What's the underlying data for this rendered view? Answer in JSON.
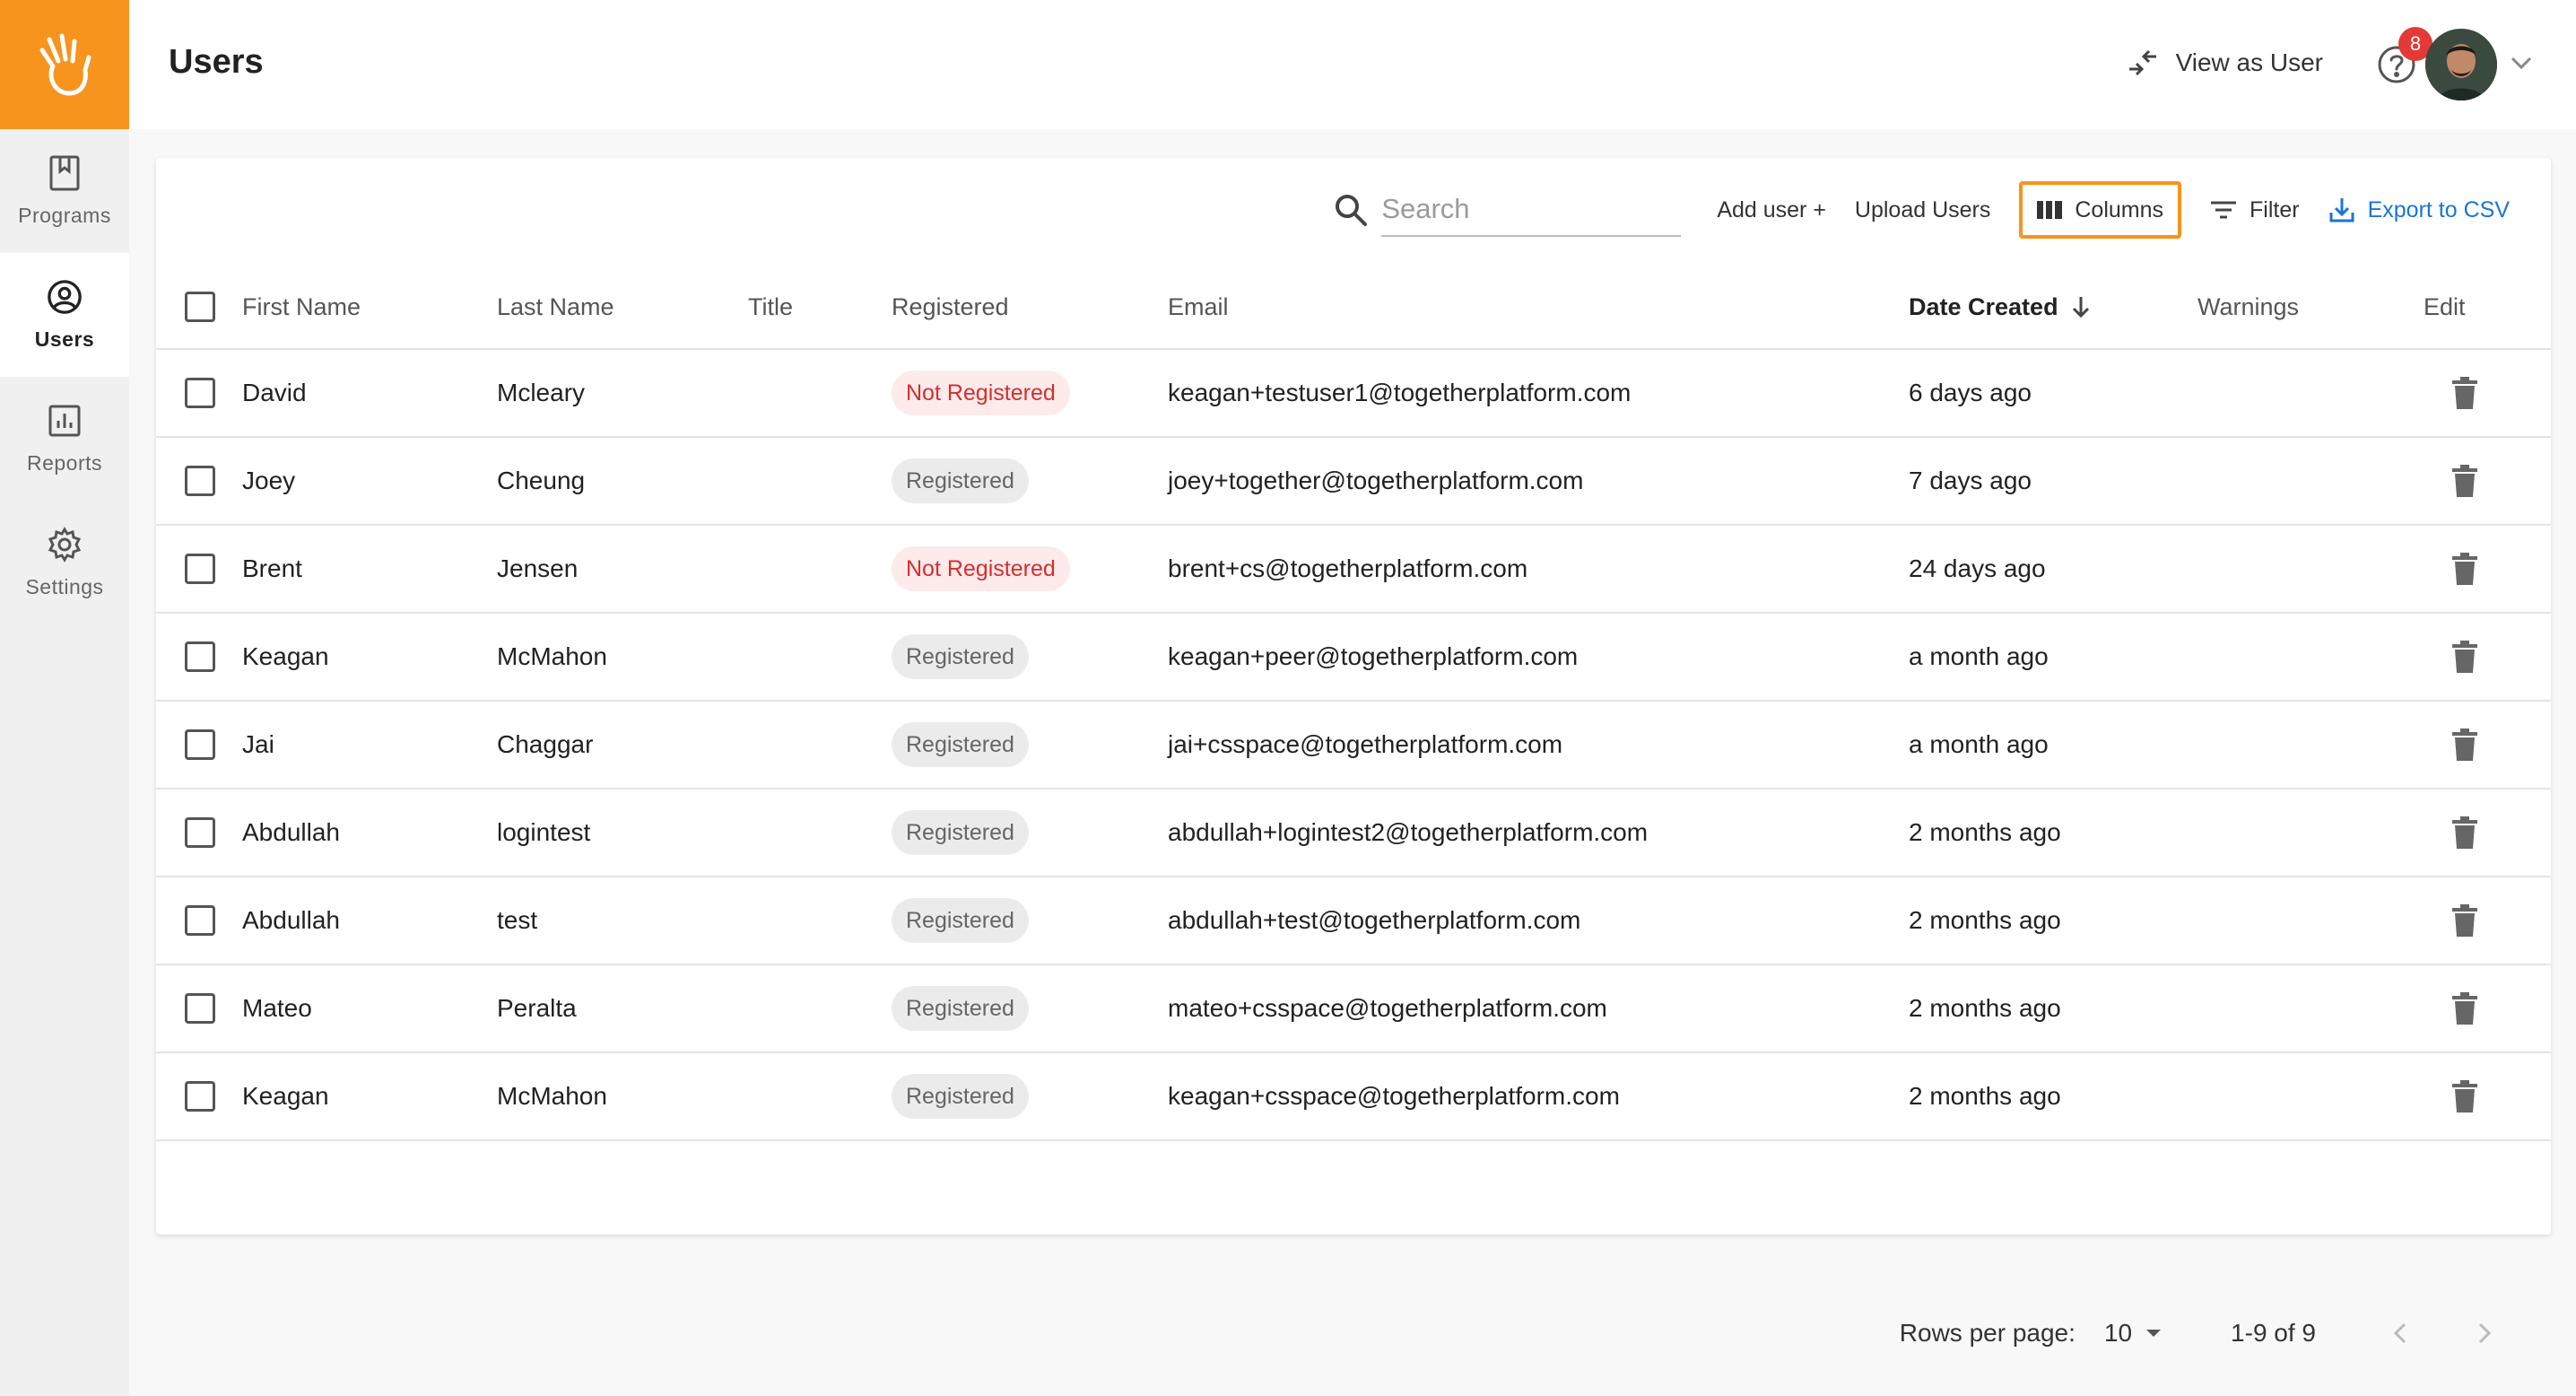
{
  "header": {
    "title": "Users",
    "view_as_label": "View as User",
    "help_badge": "8"
  },
  "sidebar": {
    "items": [
      {
        "label": "Programs",
        "icon": "bookmark-icon",
        "active": false
      },
      {
        "label": "Users",
        "icon": "user-circle-icon",
        "active": true
      },
      {
        "label": "Reports",
        "icon": "bar-chart-icon",
        "active": false
      },
      {
        "label": "Settings",
        "icon": "gear-icon",
        "active": false
      }
    ]
  },
  "toolbar": {
    "search_placeholder": "Search",
    "add_user_label": "Add user +",
    "upload_label": "Upload Users",
    "columns_label": "Columns",
    "filter_label": "Filter",
    "export_label": "Export to CSV"
  },
  "table": {
    "columns": {
      "first": "First Name",
      "last": "Last Name",
      "title": "Title",
      "registered": "Registered",
      "email": "Email",
      "date": "Date Created",
      "warnings": "Warnings",
      "edit": "Edit"
    },
    "rows": [
      {
        "first": "David",
        "last": "Mcleary",
        "status": "Not Registered",
        "email": "keagan+testuser1@togetherplatform.com",
        "date": "6 days ago"
      },
      {
        "first": "Joey",
        "last": "Cheung",
        "status": "Registered",
        "email": "joey+together@togetherplatform.com",
        "date": "7 days ago"
      },
      {
        "first": "Brent",
        "last": "Jensen",
        "status": "Not Registered",
        "email": "brent+cs@togetherplatform.com",
        "date": "24 days ago"
      },
      {
        "first": "Keagan",
        "last": "McMahon",
        "status": "Registered",
        "email": "keagan+peer@togetherplatform.com",
        "date": "a month ago"
      },
      {
        "first": "Jai",
        "last": "Chaggar",
        "status": "Registered",
        "email": "jai+csspace@togetherplatform.com",
        "date": "a month ago"
      },
      {
        "first": "Abdullah",
        "last": "logintest",
        "status": "Registered",
        "email": "abdullah+logintest2@togetherplatform.com",
        "date": "2 months ago"
      },
      {
        "first": "Abdullah",
        "last": "test",
        "status": "Registered",
        "email": "abdullah+test@togetherplatform.com",
        "date": "2 months ago"
      },
      {
        "first": "Mateo",
        "last": "Peralta",
        "status": "Registered",
        "email": "mateo+csspace@togetherplatform.com",
        "date": "2 months ago"
      },
      {
        "first": "Keagan",
        "last": "McMahon",
        "status": "Registered",
        "email": "keagan+csspace@togetherplatform.com",
        "date": "2 months ago"
      }
    ]
  },
  "pagination": {
    "rows_per_page_label": "Rows per page:",
    "rows_per_page": "10",
    "range": "1-9 of 9"
  },
  "colors": {
    "brand": "#f7941d",
    "link": "#1976d2",
    "error": "#d32f2f",
    "badge": "#e53935"
  }
}
